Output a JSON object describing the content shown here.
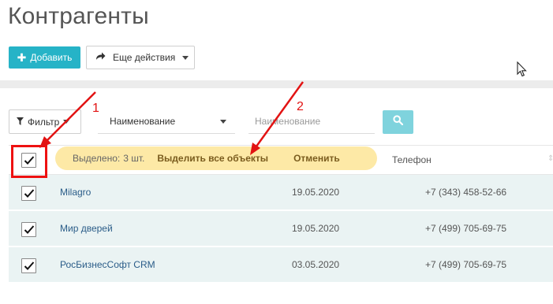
{
  "page": {
    "title": "Контрагенты"
  },
  "toolbar": {
    "add_label": "Добавить",
    "more_actions_label": "Еще действия"
  },
  "filters": {
    "filter_label": "Фильтр",
    "field_selected": "Наименование",
    "search_placeholder": "Наименование"
  },
  "selection": {
    "selected_label": "Выделено:",
    "selected_count": "3 шт.",
    "select_all_label": "Выделить все объекты",
    "cancel_label": "Отменить"
  },
  "table": {
    "phone_header": "Телефон",
    "rows": [
      {
        "name": "Milagro",
        "date": "19.05.2020",
        "phone": "+7 (343) 458-52-66"
      },
      {
        "name": "Мир дверей",
        "date": "19.05.2020",
        "phone": "+7 (499) 705-69-75"
      },
      {
        "name": "РосБизнесСофт CRM",
        "date": "03.05.2020",
        "phone": "+7 (499) 705-69-75"
      }
    ]
  },
  "annotations": {
    "label_1": "1",
    "label_2": "2",
    "color": "#e21313"
  },
  "colors": {
    "accent": "#26b3c7",
    "search_button": "#7fd3dd",
    "selection_bar": "#fde9a6",
    "row_background": "#eaf3f3",
    "link": "#2a5c88"
  },
  "icons": {
    "add": "plus-icon",
    "more": "share-arrow-icon",
    "filter": "funnel-icon",
    "search": "magnifier-icon",
    "checkbox": "checkmark-icon",
    "cursor": "mouse-pointer-icon"
  }
}
